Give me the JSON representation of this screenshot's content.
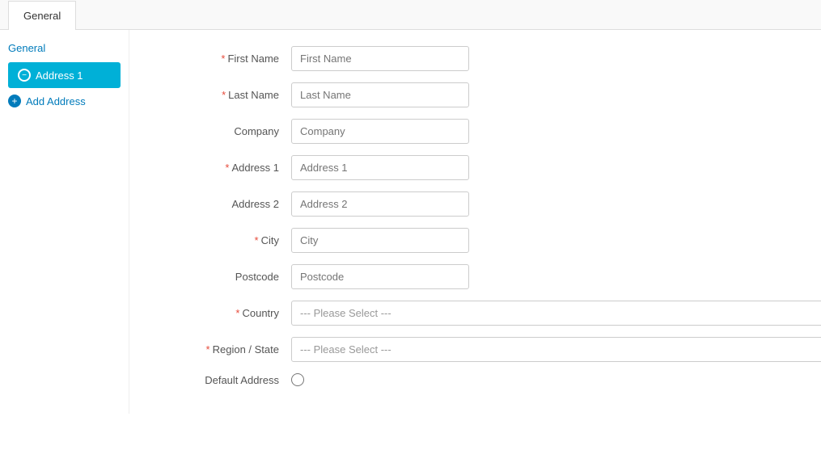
{
  "tab": {
    "label": "General"
  },
  "sidebar": {
    "general_link": "General",
    "address_btn_label": "Address 1",
    "add_address_label": "Add Address"
  },
  "form": {
    "first_name": {
      "label": "First Name",
      "placeholder": "First Name",
      "required": true
    },
    "last_name": {
      "label": "Last Name",
      "placeholder": "Last Name",
      "required": true
    },
    "company": {
      "label": "Company",
      "placeholder": "Company",
      "required": false
    },
    "address1": {
      "label": "Address 1",
      "placeholder": "Address 1",
      "required": true
    },
    "address2": {
      "label": "Address 2",
      "placeholder": "Address 2",
      "required": false
    },
    "city": {
      "label": "City",
      "placeholder": "City",
      "required": true
    },
    "postcode": {
      "label": "Postcode",
      "placeholder": "Postcode",
      "required": false
    },
    "country": {
      "label": "Country",
      "placeholder": "--- Please Select ---",
      "required": true
    },
    "region_state": {
      "label": "Region / State",
      "placeholder": "--- Please Select ---",
      "required": true
    },
    "default_address": {
      "label": "Default Address",
      "required": false
    }
  }
}
